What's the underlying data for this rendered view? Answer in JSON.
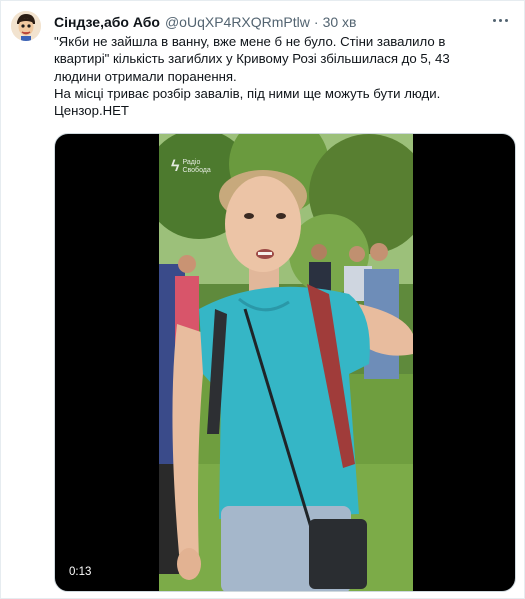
{
  "tweet": {
    "display_name": "Сіндзе,або Або",
    "handle": "@oUqXP4RXQRmPtlw",
    "separator": "·",
    "time": "30 хв",
    "text_lines": [
      "\"Якби не зайшла в ванну, вже мене б не було. Стіни завалило в",
      "квартирі\" кількість загиблих у Кривому Розі збільшилася до 5, 43",
      "людини отримали поранення.",
      "На місці триває розбір завалів, під ними ще можуть бути люди.",
      "Цензор.НЕТ"
    ]
  },
  "video": {
    "duration": "0:13",
    "watermark_mark": "ϟ",
    "watermark_line1": "Радіо",
    "watermark_line2": "Свобода"
  },
  "icons": {
    "more": "more-horizontal-icon",
    "avatar": "avatar-image"
  }
}
